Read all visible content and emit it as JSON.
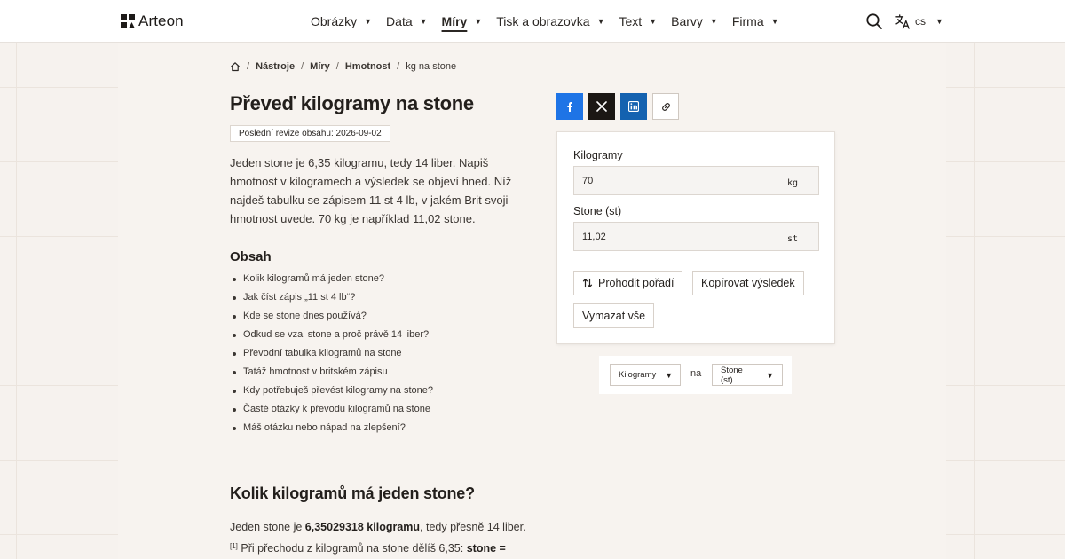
{
  "header": {
    "brand": "Arteon",
    "nav": [
      {
        "label": "Obrázky",
        "active": false
      },
      {
        "label": "Data",
        "active": false
      },
      {
        "label": "Míry",
        "active": true
      },
      {
        "label": "Tisk a obrazovka",
        "active": false
      },
      {
        "label": "Text",
        "active": false
      },
      {
        "label": "Barvy",
        "active": false
      },
      {
        "label": "Firma",
        "active": false
      }
    ],
    "search_icon": "search-icon",
    "language": "cs"
  },
  "breadcrumb": {
    "home_icon": "home-icon",
    "items": [
      "Nástroje",
      "Míry",
      "Hmotnost"
    ],
    "current": "kg na stone"
  },
  "page": {
    "title": "Převeď kilogramy na stone",
    "revision": "Poslední revize obsahu: 2026-09-02",
    "intro": "Jeden stone je 6,35 kilogramu, tedy 14 liber. Napiš hmotnost v kilogramech a výsledek se objeví hned. Níž najdeš tabulku se zápisem 11 st 4 lb, v jakém Brit svoji hmotnost uvede. 70 kg je například 11,02 stone."
  },
  "toc": {
    "title": "Obsah",
    "items": [
      "Kolik kilogramů má jeden stone?",
      "Jak číst zápis „11 st 4 lb“?",
      "Kde se stone dnes používá?",
      "Odkud se vzal stone a proč právě 14 liber?",
      "Převodní tabulka kilogramů na stone",
      "Tatáž hmotnost v britském zápisu",
      "Kdy potřebuješ převést kilogramy na stone?",
      "Časté otázky k převodu kilogramů na stone",
      "Máš otázku nebo nápad na zlepšení?"
    ]
  },
  "section": {
    "heading": "Kolik kilogramů má jeden stone?",
    "p_before": "Jeden stone je ",
    "p_bold": "6,35029318 kilogramu",
    "p_after": ", tedy přesně 14 liber.",
    "footnote": "[1]",
    "p2_before": " Při přechodu z kilogramů na stone dělíš 6,35: ",
    "p2_bold": "stone ="
  },
  "share": {
    "icons": [
      "facebook-icon",
      "x-icon",
      "linkedin-icon",
      "link-icon"
    ],
    "colors": {
      "facebook": "#1e74e6",
      "x": "#1b1714",
      "linkedin": "#1462b0"
    }
  },
  "converter": {
    "from_label": "Kilogramy",
    "from_value": "70",
    "from_unit": "kg",
    "to_label": "Stone (st)",
    "to_value": "11,02",
    "to_unit": "st",
    "swap_label": "Prohodit pořadí",
    "copy_label": "Kopírovat výsledek",
    "clear_label": "Vymazat vše"
  },
  "unit_selector": {
    "from": "Kilogramy",
    "connector": "na",
    "to": "Stone (st)"
  }
}
